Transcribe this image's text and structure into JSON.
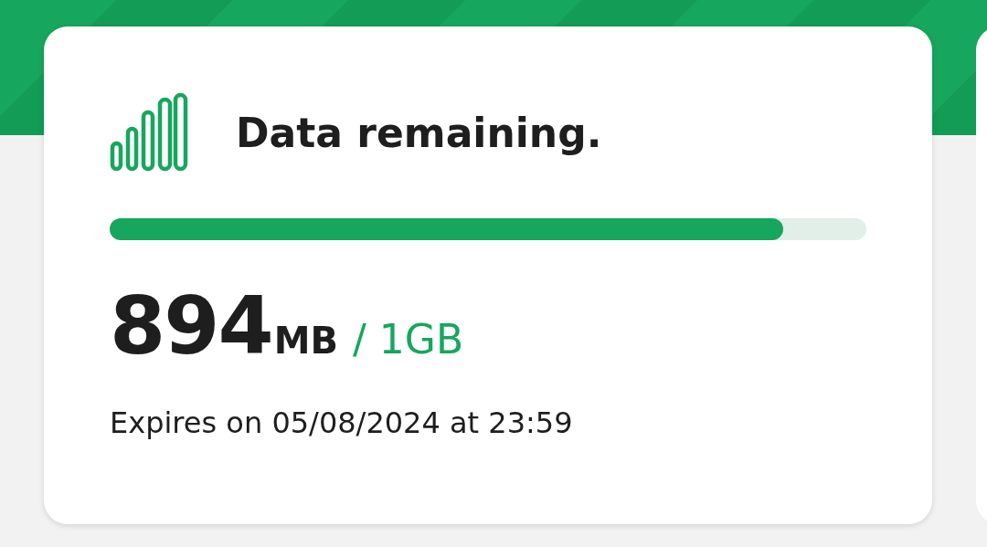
{
  "card": {
    "title": "Data remaining.",
    "level": 0.89,
    "amount": "894",
    "unit": "MB",
    "total": "/ 1GB",
    "expiry": "Expires on 05/08/2024 at 23:59"
  }
}
